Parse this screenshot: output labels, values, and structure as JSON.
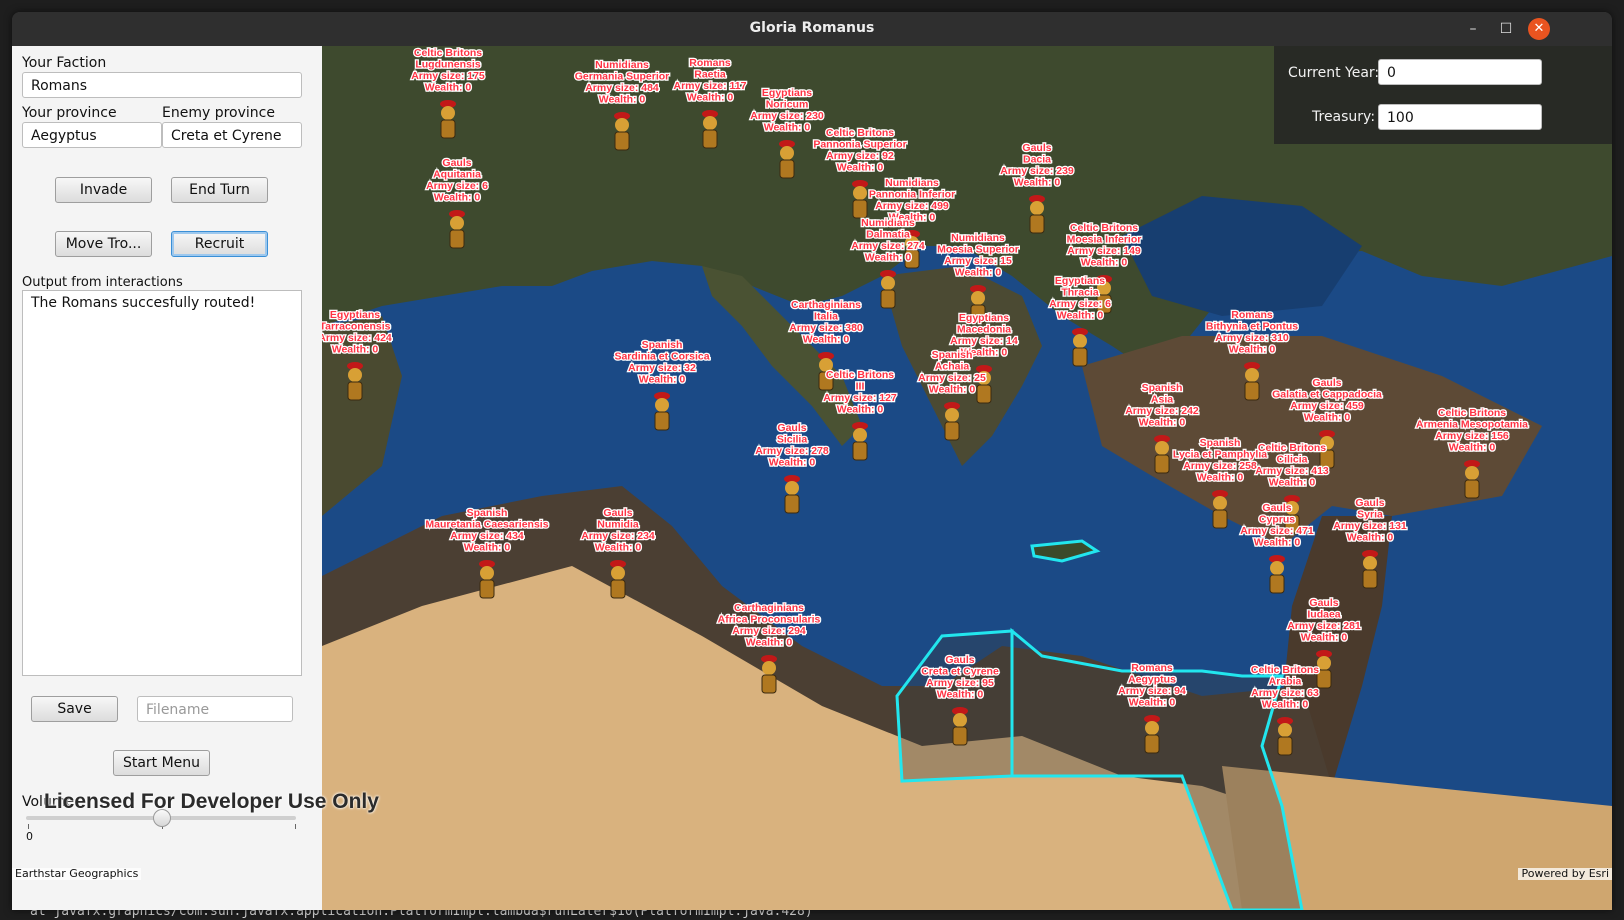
{
  "window": {
    "title": "Gloria Romanus"
  },
  "background": {
    "terminal_line": "at javafx.graphics/com.sun.javafx.application.PlatformImpl.lambda$runLater$10(PlatformImpl.java:428)"
  },
  "controls": {
    "faction_label": "Your Faction",
    "faction_value": "Romans",
    "your_province_label": "Your province",
    "your_province_value": "Aegyptus",
    "enemy_province_label": "Enemy province",
    "enemy_province_value": "Creta et Cyrene",
    "invade_label": "Invade",
    "end_turn_label": "End Turn",
    "move_troops_label": "Move Tro...",
    "recruit_label": "Recruit",
    "output_label": "Output from interactions",
    "output_text": "The Romans succesfully routed!",
    "save_label": "Save",
    "filename_placeholder": "Filename",
    "start_menu_label": "Start Menu",
    "volume_label": "Volume",
    "volume_min": "0",
    "volume_level": 0.5
  },
  "status": {
    "current_year_label": "Current Year:",
    "current_year_value": "0",
    "treasury_label": "Treasury:",
    "treasury_value": "100"
  },
  "map": {
    "license_watermark": "Licensed For Developer Use Only",
    "attribution_left": "Earthstar Geographics",
    "attribution_right": "Powered by Esri",
    "colors": {
      "label_text": "#ff3344",
      "highlight": "#22e6ee",
      "sea": "#1c4f8f",
      "desert": "#d9b27e"
    },
    "provinces": [
      {
        "lines": [
          "Celtic Britons",
          "Lugdunensis",
          "Army size: 175",
          "Wealth: 0"
        ]
      },
      {
        "lines": [
          "Numidians",
          "Germania Superior",
          "Army size: 484",
          "Wealth: 0"
        ]
      },
      {
        "lines": [
          "Romans",
          "Raetia",
          "Army size: 117",
          "Wealth: 0"
        ]
      },
      {
        "lines": [
          "Egyptians",
          "Noricum",
          "Army size: 230",
          "Wealth: 0"
        ]
      },
      {
        "lines": [
          "Celtic Britons",
          "Pannonia Superior",
          "Army size: 92",
          "Wealth: 0"
        ]
      },
      {
        "lines": [
          "Gauls",
          "Aquitania",
          "Army size: 6",
          "Wealth: 0"
        ]
      },
      {
        "lines": [
          "Gauls",
          "Dacia",
          "Army size: 239",
          "Wealth: 0"
        ]
      },
      {
        "lines": [
          "Numidians",
          "Pannonia Inferior",
          "Army size: 499",
          "Wealth: 0"
        ]
      },
      {
        "lines": [
          "Numidians",
          "Dalmatia",
          "Army size: 274",
          "Wealth: 0"
        ]
      },
      {
        "lines": [
          "Numidians",
          "Moesia Superior",
          "Army size: 15",
          "Wealth: 0"
        ]
      },
      {
        "lines": [
          "Celtic Britons",
          "Moesia Inferior",
          "Army size: 149",
          "Wealth: 0"
        ]
      },
      {
        "lines": [
          "Egyptians",
          "Thracia",
          "Army size: 6",
          "Wealth: 0"
        ]
      },
      {
        "lines": [
          "Egyptians",
          "Tarraconensis",
          "Army size: 424",
          "Wealth: 0"
        ]
      },
      {
        "lines": [
          "Egyptians",
          "Macedonia",
          "Army size: 14",
          "Wealth: 0"
        ]
      },
      {
        "lines": [
          "Romans",
          "Bithynia et Pontus",
          "Army size: 310",
          "Wealth: 0"
        ]
      },
      {
        "lines": [
          "Spanish",
          "Sardinia et Corsica",
          "Army size: 32",
          "Wealth: 0"
        ]
      },
      {
        "lines": [
          "Spanish",
          "Achaia",
          "Army size: 25",
          "Wealth: 0"
        ]
      },
      {
        "lines": [
          "Spanish",
          "Asia",
          "Army size: 242",
          "Wealth: 0"
        ]
      },
      {
        "lines": [
          "Gauls",
          "Galatia et Cappadocia",
          "Army size: 459",
          "Wealth: 0"
        ]
      },
      {
        "lines": [
          "Celtic Britons",
          "Armenia Mesopotamia",
          "Army size: 156",
          "Wealth: 0"
        ]
      },
      {
        "lines": [
          "Gauls",
          "Sicilia",
          "Army size: 278",
          "Wealth: 0"
        ]
      },
      {
        "lines": [
          "Spanish",
          "Lycia et Pamphylia",
          "Army size: 258",
          "Wealth: 0"
        ]
      },
      {
        "lines": [
          "Celtic Britons",
          "Cilicia",
          "Army size: 413",
          "Wealth: 0"
        ]
      },
      {
        "lines": [
          "Gauls",
          "Syria",
          "Army size: 131",
          "Wealth: 0"
        ]
      },
      {
        "lines": [
          "Gauls",
          "Cyprus",
          "Army size: 471",
          "Wealth: 0"
        ]
      },
      {
        "lines": [
          "Spanish",
          "Mauretania Caesariensis",
          "Army size: 434",
          "Wealth: 0"
        ]
      },
      {
        "lines": [
          "Gauls",
          "Numidia",
          "Army size: 234",
          "Wealth: 0"
        ]
      },
      {
        "lines": [
          "Carthaginians",
          "Africa Proconsularis",
          "Army size: 294",
          "Wealth: 0"
        ]
      },
      {
        "lines": [
          "Gauls",
          "Iudaea",
          "Army size: 281",
          "Wealth: 0"
        ]
      },
      {
        "lines": [
          "Gauls",
          "Creta et Cyrene",
          "Army size: 95",
          "Wealth: 0"
        ]
      },
      {
        "lines": [
          "Romans",
          "Aegyptus",
          "Army size: 94",
          "Wealth: 0"
        ]
      },
      {
        "lines": [
          "Celtic Britons",
          "Arabia",
          "Army size: 63",
          "Wealth: 0"
        ]
      },
      {
        "lines": [
          "Carthaginians",
          "Italia",
          "Army size: 380",
          "Wealth: 0"
        ]
      },
      {
        "lines": [
          "Celtic Britons",
          "III",
          "Army size: 127",
          "Wealth: 0"
        ]
      }
    ]
  }
}
